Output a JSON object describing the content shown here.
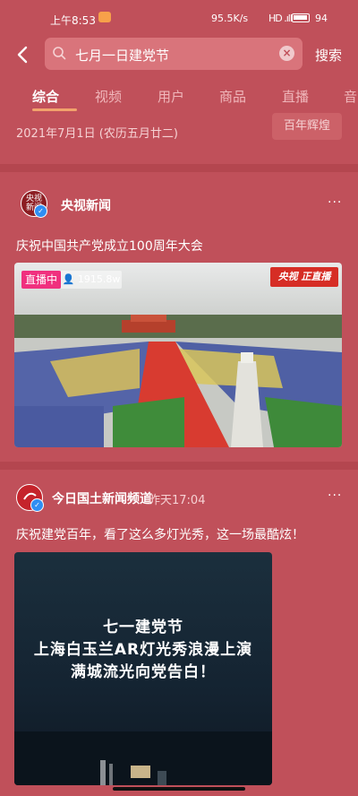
{
  "status_bar": {
    "time": "上午8:53",
    "net_speed": "95.5K/s",
    "signal": "HD .ıll",
    "battery": "94"
  },
  "search": {
    "query": "七月一日建党节",
    "submit_label": "搜索"
  },
  "tabs": [
    {
      "label": "综合",
      "active": true
    },
    {
      "label": "视频",
      "active": false
    },
    {
      "label": "用户",
      "active": false
    },
    {
      "label": "商品",
      "active": false
    },
    {
      "label": "直播",
      "active": false
    },
    {
      "label": "音",
      "active": false
    }
  ],
  "date_info": "2021年7月1日 (农历五月廿二)",
  "chip_label": "百年辉煌",
  "posts": [
    {
      "avatar_text": "央视\n新闻",
      "author": "央视新闻",
      "time": "",
      "title": "庆祝中国共产党成立100周年大会",
      "live_badge": "直播中",
      "viewers": "1915.8w",
      "logo_text": "央视 正直播"
    },
    {
      "avatar_text": "",
      "author": "今日国土新闻频道",
      "time": "昨天17:04",
      "title": "庆祝建党百年，看了这么多灯光秀，这一场最酷炫！",
      "video_lines": [
        "七一建党节",
        "上海白玉兰AR灯光秀浪漫上演",
        "满城流光向党告白！"
      ]
    }
  ],
  "colors": {
    "background": "#c0505a",
    "accent_underline": "#f2a36c",
    "live_badge": "#f0307e",
    "verify": "#2f8ef3"
  },
  "icons": [
    "back-arrow-icon",
    "search-icon",
    "clear-icon",
    "verify-icon",
    "more-icon",
    "viewer-icon"
  ]
}
